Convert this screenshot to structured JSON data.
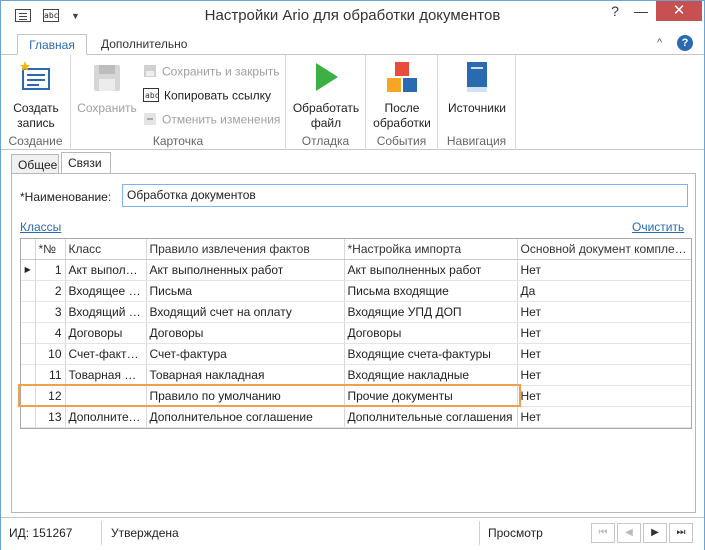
{
  "window": {
    "title": "Настройки Ario для обработки документов"
  },
  "ribbon": {
    "tabs": [
      "Главная",
      "Дополнительно"
    ],
    "groups": {
      "create": {
        "label": "Создание",
        "create_record": "Создать запись"
      },
      "card": {
        "label": "Карточка",
        "save": "Сохранить",
        "save_close": "Сохранить и закрыть",
        "copy_link": "Копировать ссылку",
        "cancel_changes": "Отменить изменения"
      },
      "debug": {
        "label": "Отладка",
        "process_file": "Обработать файл"
      },
      "events": {
        "label": "События",
        "after_processing": "После обработки"
      },
      "navigation": {
        "label": "Навигация",
        "sources": "Источники"
      }
    }
  },
  "content_tabs": [
    "Общее",
    "Связи"
  ],
  "form": {
    "name_label": "*Наименование:",
    "name_value": "Обработка документов"
  },
  "classes": {
    "link": "Классы",
    "clear": "Очистить",
    "columns": [
      "*№",
      "Класс",
      "Правило извлечения фактов",
      "*Настройка импорта",
      "Основной документ комплекта"
    ],
    "rows": [
      {
        "num": "1",
        "cls": "Акт выполненных работ",
        "rule": "Акт выполненных работ",
        "import": "Акт выполненных работ",
        "main": "Нет"
      },
      {
        "num": "2",
        "cls": "Входящее письмо",
        "rule": "Письма",
        "import": "Письма входящие",
        "main": "Да"
      },
      {
        "num": "3",
        "cls": "Входящий счет на оплату",
        "rule": "Входящий счет на оплату",
        "import": "Входящие УПД ДОП",
        "main": "Нет"
      },
      {
        "num": "4",
        "cls": "Договоры",
        "rule": "Договоры",
        "import": "Договоры",
        "main": "Нет"
      },
      {
        "num": "10",
        "cls": "Счет-фактура",
        "rule": "Счет-фактура",
        "import": "Входящие счета-фактуры",
        "main": "Нет"
      },
      {
        "num": "11",
        "cls": "Товарная накладная",
        "rule": "Товарная накладная",
        "import": "Входящие накладные",
        "main": "Нет"
      },
      {
        "num": "12",
        "cls": "",
        "rule": "Правило по умолчанию",
        "import": "Прочие документы",
        "main": "Нет"
      },
      {
        "num": "13",
        "cls": "Дополнительное соглашение",
        "rule": "Дополнительное соглашение",
        "import": "Дополнительные соглашения",
        "main": "Нет"
      }
    ],
    "current_row_indicator": "▶"
  },
  "status": {
    "id": "ИД: 151267",
    "state": "Утверждена",
    "mode": "Просмотр"
  },
  "colors": {
    "accent": "#2a6ab0",
    "highlight": "#f0a048",
    "close_button": "#c75050"
  }
}
